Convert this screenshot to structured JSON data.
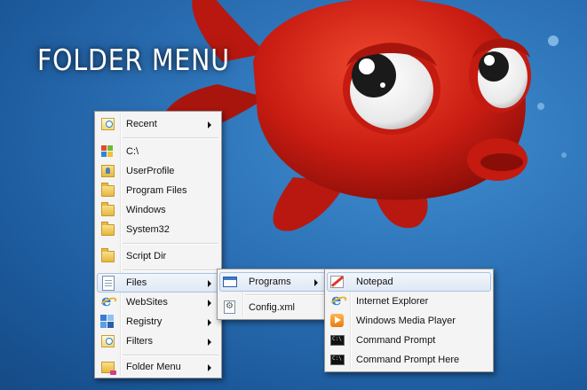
{
  "title": "FOLDER MENU",
  "main_menu": {
    "items": [
      {
        "label": "Recent",
        "icon": "recent-folder-icon"
      },
      {
        "label": "C:\\",
        "icon": "windows-logo-icon"
      },
      {
        "label": "UserProfile",
        "icon": "user-folder-icon"
      },
      {
        "label": "Program Files",
        "icon": "folder-icon"
      },
      {
        "label": "Windows",
        "icon": "folder-icon"
      },
      {
        "label": "System32",
        "icon": "folder-icon"
      },
      {
        "label": "Script Dir",
        "icon": "folder-icon"
      },
      {
        "label": "Files",
        "icon": "files-icon"
      },
      {
        "label": "WebSites",
        "icon": "internet-explorer-icon"
      },
      {
        "label": "Registry",
        "icon": "registry-icon"
      },
      {
        "label": "Filters",
        "icon": "filter-folder-icon"
      },
      {
        "label": "Folder Menu",
        "icon": "folder-menu-icon"
      }
    ]
  },
  "files_submenu": {
    "items": [
      {
        "label": "Programs",
        "icon": "window-icon"
      },
      {
        "label": "Config.xml",
        "icon": "xml-file-icon"
      }
    ]
  },
  "programs_submenu": {
    "items": [
      {
        "label": "Notepad",
        "icon": "notepad-icon"
      },
      {
        "label": "Internet Explorer",
        "icon": "internet-explorer-icon"
      },
      {
        "label": "Windows Media Player",
        "icon": "media-player-icon"
      },
      {
        "label": "Command Prompt",
        "icon": "command-prompt-icon"
      },
      {
        "label": "Command Prompt Here",
        "icon": "command-prompt-icon"
      }
    ]
  },
  "colors": {
    "highlight": "#dfe8f5",
    "highlight_border": "#a8c3e3",
    "menu_bg": "#f4f4f4",
    "desktop_blue": "#2b6fb4",
    "fish_red": "#d8231b"
  }
}
